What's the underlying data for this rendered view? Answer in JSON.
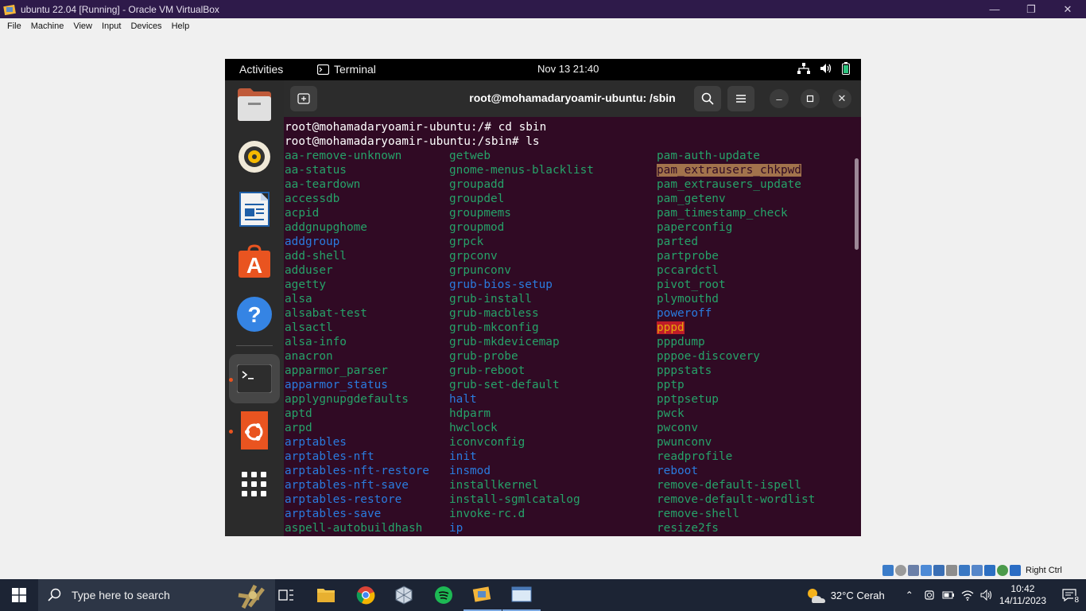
{
  "host": {
    "window_title": "ubuntu 22.04 [Running] - Oracle VM VirtualBox",
    "menu": [
      "File",
      "Machine",
      "View",
      "Input",
      "Devices",
      "Help"
    ],
    "status_host_key": "Right Ctrl"
  },
  "guest": {
    "topbar": {
      "activities": "Activities",
      "app_name": "Terminal",
      "clock": "Nov 13  21:40"
    },
    "terminal": {
      "title": "root@mohamadaryoamir-ubuntu: /sbin",
      "lines": [
        "root@mohamadaryoamir-ubuntu:/# cd sbin",
        "root@mohamadaryoamir-ubuntu:/sbin# ls"
      ],
      "columns": [
        [
          {
            "t": "aa-remove-unknown",
            "c": "green"
          },
          {
            "t": "aa-status",
            "c": "green"
          },
          {
            "t": "aa-teardown",
            "c": "green"
          },
          {
            "t": "accessdb",
            "c": "green"
          },
          {
            "t": "acpid",
            "c": "green"
          },
          {
            "t": "addgnupghome",
            "c": "green"
          },
          {
            "t": "addgroup",
            "c": "blue"
          },
          {
            "t": "add-shell",
            "c": "green"
          },
          {
            "t": "adduser",
            "c": "green"
          },
          {
            "t": "agetty",
            "c": "green"
          },
          {
            "t": "alsa",
            "c": "green"
          },
          {
            "t": "alsabat-test",
            "c": "green"
          },
          {
            "t": "alsactl",
            "c": "green"
          },
          {
            "t": "alsa-info",
            "c": "green"
          },
          {
            "t": "anacron",
            "c": "green"
          },
          {
            "t": "apparmor_parser",
            "c": "green"
          },
          {
            "t": "apparmor_status",
            "c": "blue"
          },
          {
            "t": "applygnupgdefaults",
            "c": "green"
          },
          {
            "t": "aptd",
            "c": "green"
          },
          {
            "t": "arpd",
            "c": "green"
          },
          {
            "t": "arptables",
            "c": "blue"
          },
          {
            "t": "arptables-nft",
            "c": "blue"
          },
          {
            "t": "arptables-nft-restore",
            "c": "blue"
          },
          {
            "t": "arptables-nft-save",
            "c": "blue"
          },
          {
            "t": "arptables-restore",
            "c": "blue"
          },
          {
            "t": "arptables-save",
            "c": "blue"
          },
          {
            "t": "aspell-autobuildhash",
            "c": "green"
          }
        ],
        [
          {
            "t": "getweb",
            "c": "green"
          },
          {
            "t": "gnome-menus-blacklist",
            "c": "green"
          },
          {
            "t": "groupadd",
            "c": "green"
          },
          {
            "t": "groupdel",
            "c": "green"
          },
          {
            "t": "groupmems",
            "c": "green"
          },
          {
            "t": "groupmod",
            "c": "green"
          },
          {
            "t": "grpck",
            "c": "green"
          },
          {
            "t": "grpconv",
            "c": "green"
          },
          {
            "t": "grpunconv",
            "c": "green"
          },
          {
            "t": "grub-bios-setup",
            "c": "blue"
          },
          {
            "t": "grub-install",
            "c": "green"
          },
          {
            "t": "grub-macbless",
            "c": "green"
          },
          {
            "t": "grub-mkconfig",
            "c": "green"
          },
          {
            "t": "grub-mkdevicemap",
            "c": "green"
          },
          {
            "t": "grub-probe",
            "c": "green"
          },
          {
            "t": "grub-reboot",
            "c": "green"
          },
          {
            "t": "grub-set-default",
            "c": "green"
          },
          {
            "t": "halt",
            "c": "blue"
          },
          {
            "t": "hdparm",
            "c": "green"
          },
          {
            "t": "hwclock",
            "c": "green"
          },
          {
            "t": "iconvconfig",
            "c": "green"
          },
          {
            "t": "init",
            "c": "blue"
          },
          {
            "t": "insmod",
            "c": "blue"
          },
          {
            "t": "installkernel",
            "c": "green"
          },
          {
            "t": "install-sgmlcatalog",
            "c": "green"
          },
          {
            "t": "invoke-rc.d",
            "c": "green"
          },
          {
            "t": "ip",
            "c": "blue"
          }
        ],
        [
          {
            "t": "pam-auth-update",
            "c": "green"
          },
          {
            "t": "pam_extrausers_chkpwd",
            "c": "hl-orange"
          },
          {
            "t": "pam_extrausers_update",
            "c": "green"
          },
          {
            "t": "pam_getenv",
            "c": "green"
          },
          {
            "t": "pam_timestamp_check",
            "c": "green"
          },
          {
            "t": "paperconfig",
            "c": "green"
          },
          {
            "t": "parted",
            "c": "green"
          },
          {
            "t": "partprobe",
            "c": "green"
          },
          {
            "t": "pccardctl",
            "c": "green"
          },
          {
            "t": "pivot_root",
            "c": "green"
          },
          {
            "t": "plymouthd",
            "c": "green"
          },
          {
            "t": "poweroff",
            "c": "blue"
          },
          {
            "t": "pppd",
            "c": "hl-red"
          },
          {
            "t": "pppdump",
            "c": "green"
          },
          {
            "t": "pppoe-discovery",
            "c": "green"
          },
          {
            "t": "pppstats",
            "c": "green"
          },
          {
            "t": "pptp",
            "c": "green"
          },
          {
            "t": "pptpsetup",
            "c": "green"
          },
          {
            "t": "pwck",
            "c": "green"
          },
          {
            "t": "pwconv",
            "c": "green"
          },
          {
            "t": "pwunconv",
            "c": "green"
          },
          {
            "t": "readprofile",
            "c": "green"
          },
          {
            "t": "reboot",
            "c": "blue"
          },
          {
            "t": "remove-default-ispell",
            "c": "green"
          },
          {
            "t": "remove-default-wordlist",
            "c": "green"
          },
          {
            "t": "remove-shell",
            "c": "green"
          },
          {
            "t": "resize2fs",
            "c": "green"
          }
        ]
      ]
    },
    "dock": [
      {
        "name": "files-icon"
      },
      {
        "name": "rhythmbox-icon"
      },
      {
        "name": "writer-icon"
      },
      {
        "name": "app-center-icon"
      },
      {
        "name": "help-icon"
      },
      {
        "name": "terminal-icon"
      },
      {
        "name": "ubuntu-icon"
      },
      {
        "name": "show-apps-icon"
      }
    ]
  },
  "taskbar": {
    "search_placeholder": "Type here to search",
    "weather": "32°C  Cerah",
    "time": "10:42",
    "date": "14/11/2023",
    "notification_count": "8"
  },
  "colors": {
    "terminal_bg": "#300a24",
    "ls_green": "#26a269",
    "ls_blue": "#2a7bde",
    "accent": "#e95420"
  }
}
